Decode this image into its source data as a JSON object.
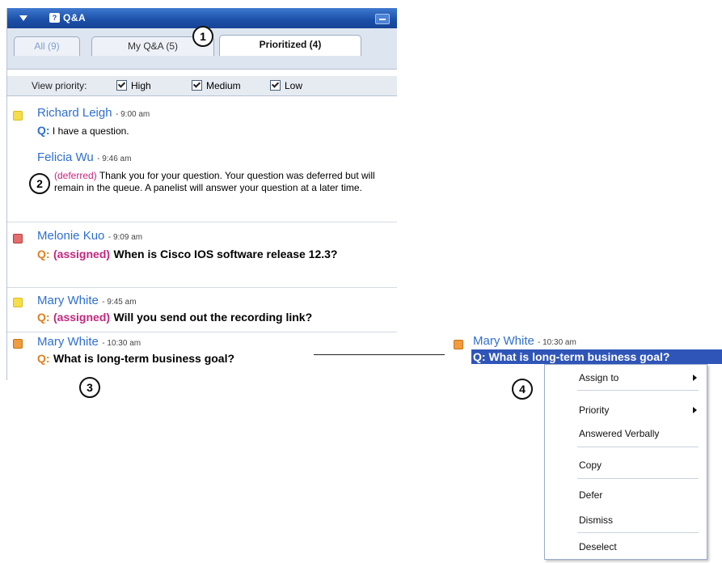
{
  "panel": {
    "title": "Q&A",
    "tabs": [
      {
        "label": "All (9)"
      },
      {
        "label": "My Q&A (5)"
      },
      {
        "label": "Prioritized (4)"
      }
    ],
    "view_priority_label": "View priority:",
    "priorities": [
      {
        "label": "High",
        "checked": true
      },
      {
        "label": "Medium",
        "checked": true
      },
      {
        "label": "Low",
        "checked": true
      }
    ]
  },
  "items": [
    {
      "priority_color": "#f6dd4a",
      "name": "Richard Leigh",
      "time": "- 9:00 am",
      "q": "Q:",
      "question": "I have a question.",
      "answer_name": "Felicia  Wu",
      "answer_time": "- 9:46 am",
      "status": "(deferred)",
      "answer": "Thank you for your question. Your question was deferred but will remain in the queue. A panelist will answer your question at a later time."
    },
    {
      "priority_color": "#e56d6d",
      "name": "Melonie Kuo",
      "time": "- 9:09 am",
      "q": "Q:",
      "status": "(assigned)",
      "question": "When is Cisco IOS software release 12.3?"
    },
    {
      "priority_color": "#f6dd4a",
      "name": "Mary White",
      "time": "- 9:45 am",
      "q": "Q:",
      "status": "(assigned)",
      "question": "Will you send out the recording link?"
    },
    {
      "priority_color": "#f09c3f",
      "name": "Mary White",
      "time": "- 10:30 am",
      "q": "Q:",
      "question": "What is long-term business goal?"
    }
  ],
  "callouts": [
    "1",
    "2",
    "3",
    "4"
  ],
  "selected": {
    "name": "Mary White",
    "time": "- 10:30 am",
    "text": "Q: What is long-term business goal?"
  },
  "context_menu": [
    {
      "label": "Assign to",
      "submenu": true
    },
    {
      "label": "Priority",
      "submenu": true
    },
    {
      "label": "Answered Verbally"
    },
    {
      "label": "Copy"
    },
    {
      "label": "Defer"
    },
    {
      "label": "Dismiss"
    },
    {
      "label": "Deselect"
    }
  ]
}
